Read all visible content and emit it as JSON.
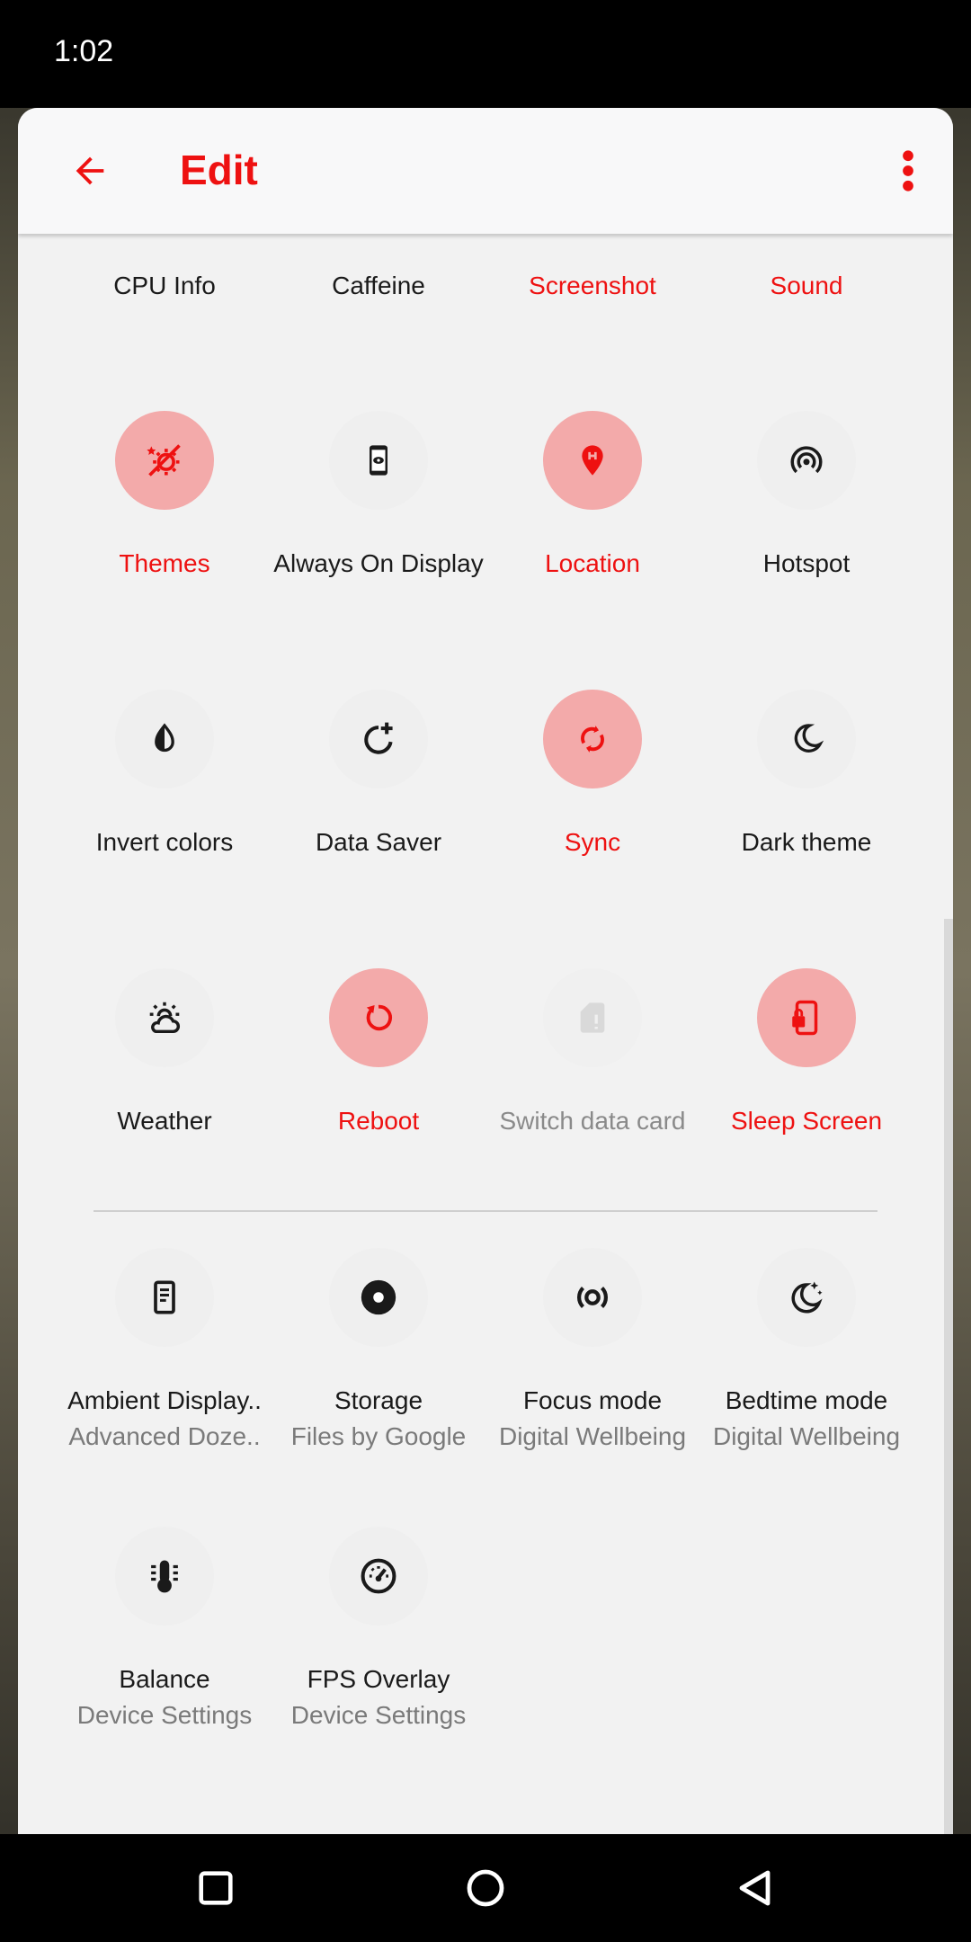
{
  "status": {
    "time": "1:02"
  },
  "header": {
    "title": "Edit"
  },
  "colors": {
    "accent": "#ee1111",
    "tile_on": "#f3aaaa",
    "tile_off": "#efefef"
  },
  "top_row": [
    "CPU Info",
    "Caffeine",
    "Screenshot",
    "Sound"
  ],
  "tiles": [
    {
      "label": "Themes",
      "icon": "themes-icon",
      "state": "on"
    },
    {
      "label": "Always On Display",
      "icon": "always-on-display-icon",
      "state": "off"
    },
    {
      "label": "Location",
      "icon": "location-icon",
      "state": "on"
    },
    {
      "label": "Hotspot",
      "icon": "hotspot-icon",
      "state": "off"
    },
    {
      "label": "Invert colors",
      "icon": "invert-colors-icon",
      "state": "off"
    },
    {
      "label": "Data Saver",
      "icon": "data-saver-icon",
      "state": "off"
    },
    {
      "label": "Sync",
      "icon": "sync-icon",
      "state": "on"
    },
    {
      "label": "Dark theme",
      "icon": "dark-theme-icon",
      "state": "off"
    },
    {
      "label": "Weather",
      "icon": "weather-icon",
      "state": "off"
    },
    {
      "label": "Reboot",
      "icon": "reboot-icon",
      "state": "on"
    },
    {
      "label": "Switch data card",
      "icon": "sim-card-icon",
      "state": "disabled"
    },
    {
      "label": "Sleep Screen",
      "icon": "sleep-screen-icon",
      "state": "on"
    }
  ],
  "available": [
    {
      "label": "Ambient Display..",
      "sub": "Advanced Doze..",
      "icon": "ambient-display-icon"
    },
    {
      "label": "Storage",
      "sub": "Files by Google",
      "icon": "storage-icon"
    },
    {
      "label": "Focus mode",
      "sub": "Digital Wellbeing",
      "icon": "focus-mode-icon"
    },
    {
      "label": "Bedtime mode",
      "sub": "Digital Wellbeing",
      "icon": "bedtime-mode-icon"
    },
    {
      "label": "Balance",
      "sub": "Device Settings",
      "icon": "balance-icon"
    },
    {
      "label": "FPS Overlay",
      "sub": "Device Settings",
      "icon": "fps-overlay-icon"
    }
  ]
}
